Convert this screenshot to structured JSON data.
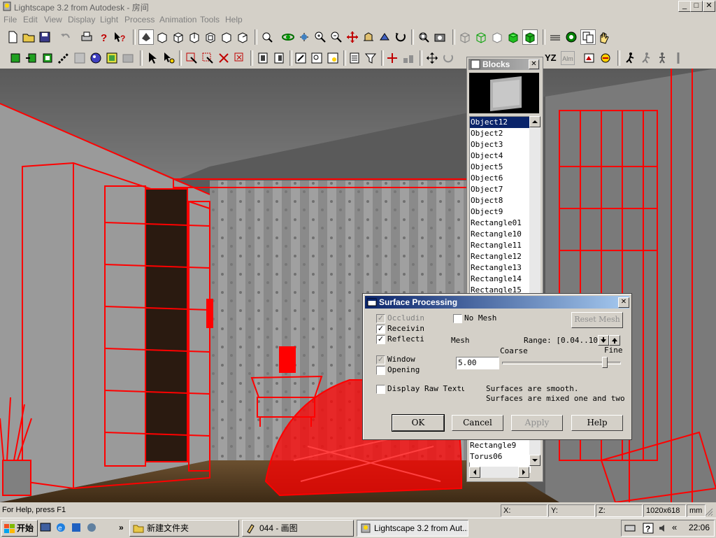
{
  "window": {
    "title": "Lightscape 3.2 from Autodesk - 房间",
    "minimize": "_",
    "maximize": "□",
    "close": "✕"
  },
  "menu": [
    "File",
    "Edit",
    "View",
    "Display",
    "Light",
    "Process",
    "Animation",
    "Tools",
    "Help"
  ],
  "toolbar2_text": {
    "yz": "YZ",
    "alm": "Alm"
  },
  "blocks": {
    "title": "Blocks",
    "close": "✕",
    "items": [
      "Object12",
      "Object2",
      "Object3",
      "Object4",
      "Object5",
      "Object6",
      "Object7",
      "Object8",
      "Object9",
      "Rectangle01",
      "Rectangle10",
      "Rectangle11",
      "Rectangle12",
      "Rectangle13",
      "Rectangle14",
      "Rectangle15"
    ],
    "items_bottom": [
      "Rectangle9",
      "Torus06"
    ],
    "selected": "Object12"
  },
  "dialog": {
    "title": "Surface Processing",
    "close": "✕",
    "occluding": "Occludin",
    "receiving": "Receivin",
    "reflecting": "Reflecti",
    "window": "Window",
    "opening": "Opening",
    "no_mesh": "No Mesh",
    "reset_mesh": "Reset Mesh",
    "mesh_label": "Mesh",
    "range_label": "Range: [0.04..10]",
    "coarse": "Coarse",
    "fine": "Fine",
    "mesh_value": "5.00",
    "slider_level": 0.88,
    "display_raw": "Display Raw Textur",
    "info_line1": "Surfaces are smooth.",
    "info_line2": "Surfaces are mixed one and two",
    "ok": "OK",
    "cancel": "Cancel",
    "apply": "Apply",
    "help": "Help"
  },
  "status": {
    "help": "For Help, press F1",
    "x": "X:",
    "y": "Y:",
    "z": "Z:",
    "size": "1020x618",
    "unit": "mm"
  },
  "taskbar": {
    "start": "开始",
    "chevron": "»",
    "tasks": [
      "新建文件夹",
      "044 - 画图",
      "Lightscape 3.2 from Aut..."
    ],
    "tray_chevron": "«",
    "clock": "22:06"
  },
  "colors": {
    "wireframe": "#ff0000",
    "selection": "#0a246a",
    "title_active": "#0a246a"
  }
}
